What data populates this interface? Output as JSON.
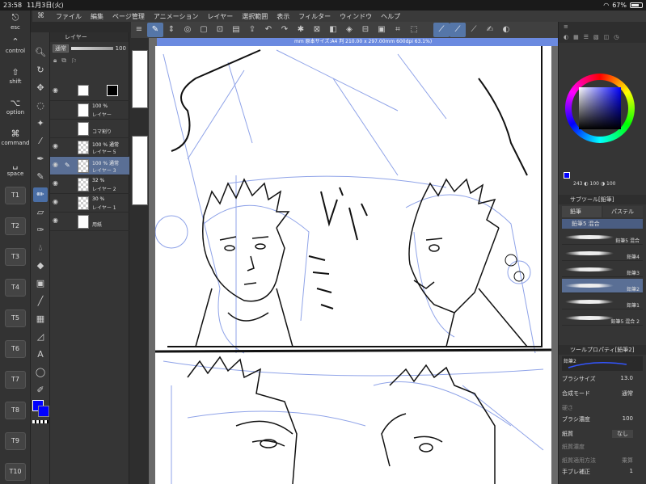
{
  "status": {
    "time": "23:58",
    "date": "11月3日(火)",
    "battery": "67%",
    "battery_level": 0.67
  },
  "menu": [
    "ファイル",
    "編集",
    "ページ管理",
    "アニメーション",
    "レイヤー",
    "選択範囲",
    "表示",
    "フィルター",
    "ウィンドウ",
    "ヘルプ"
  ],
  "modifiers": {
    "esc": "esc",
    "control": "control",
    "shift": "shift",
    "option": "option",
    "command": "command",
    "space": "space"
  },
  "tkeys": [
    "T1",
    "T2",
    "T3",
    "T4",
    "T5",
    "T6",
    "T7",
    "T8",
    "T9",
    "T10"
  ],
  "layer_panel": {
    "tab": "レイヤー",
    "blend": "通常",
    "opacity": "100",
    "layers": [
      {
        "l1": "100 %",
        "l2": "レイヤー",
        "thumb": "white"
      },
      {
        "l1": "",
        "l2": "コマ割り",
        "thumb": "white"
      },
      {
        "l1": "100 % 通常",
        "l2": "レイヤー 5",
        "thumb": "trans"
      },
      {
        "l1": "100 % 通常",
        "l2": "レイヤー 3",
        "thumb": "trans"
      },
      {
        "l1": "32 %",
        "l2": "レイヤー 2",
        "thumb": "trans"
      },
      {
        "l1": "30 %",
        "l2": "レイヤー 1",
        "thumb": "trans"
      },
      {
        "l1": "",
        "l2": "用紙",
        "thumb": "white"
      }
    ]
  },
  "canvas": {
    "title": "mm 原本サイズ:A4 判 210.00 x 297.00mm 600dpi 63.1%)"
  },
  "right": {
    "rgb": "243",
    "v1": "100",
    "v2": "100",
    "subtool_title": "サブツール[鉛筆]",
    "subtool_tabs": [
      "鉛筆",
      "パステル"
    ],
    "group": "鉛筆5 混合",
    "brushes": [
      "鉛筆5 混合",
      "鉛筆4",
      "鉛筆3",
      "鉛筆2",
      "鉛筆1",
      "鉛筆5 混合 2"
    ],
    "toolprop_title": "ツールプロパティ[鉛筆2]",
    "toolprop_name": "鉛筆2",
    "props": [
      {
        "label": "ブラシサイズ",
        "value": "13.0"
      },
      {
        "label": "合成モード",
        "value": "通常"
      },
      {
        "label": "硬さ",
        "value": ""
      },
      {
        "label": "ブラシ濃度",
        "value": "100"
      },
      {
        "label": "紙質",
        "value": "なし"
      },
      {
        "label": "紙質濃度",
        "value": ""
      },
      {
        "label": "紙質適用方法",
        "value": "乗算"
      },
      {
        "label": "手ブレ補正",
        "value": "1"
      }
    ]
  },
  "colors": {
    "accent": "#5a6f95",
    "main_color": "#0000ff",
    "sub_color": "#ffffff",
    "canvas_bar": "#6b8ae0",
    "sketch": "#8fa3e8"
  }
}
